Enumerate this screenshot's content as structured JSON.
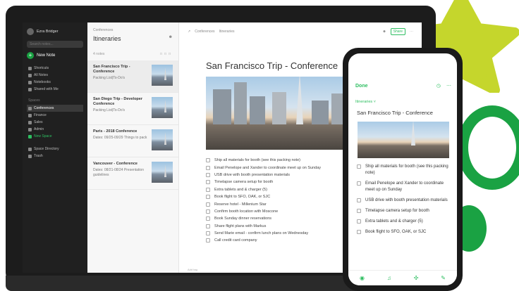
{
  "colors": {
    "accent": "#2dbe60",
    "sidebar_bg": "#202020",
    "star": "#c5d62c",
    "ring": "#1aa243"
  },
  "sidebar": {
    "account": "Ezra Bridger",
    "search_placeholder": "Search notes...",
    "new_note": "New Note",
    "items": [
      {
        "label": "Shortcuts",
        "icon": "star-icon"
      },
      {
        "label": "All Notes",
        "icon": "note-icon"
      },
      {
        "label": "Notebooks",
        "icon": "notebook-icon"
      },
      {
        "label": "Shared with Me",
        "icon": "people-icon"
      }
    ],
    "spaces_label": "Spaces",
    "spaces": [
      {
        "label": "Conferences",
        "active": true
      },
      {
        "label": "Finance"
      },
      {
        "label": "Sales"
      },
      {
        "label": "Admin"
      },
      {
        "label": "New Space",
        "green": true
      }
    ],
    "footer": [
      {
        "label": "Space Directory",
        "icon": "directory-icon"
      },
      {
        "label": "Trash",
        "icon": "trash-icon"
      }
    ]
  },
  "notelist": {
    "breadcrumb": "Conferences",
    "title": "Itineraries",
    "count": "4 notes",
    "notes": [
      {
        "title": "San Francisco Trip - Conference",
        "snippet": "Packing List|To-Do's"
      },
      {
        "title": "San Diego Trip - Developer Conference",
        "snippet": "Packing List|To-Do's"
      },
      {
        "title": "Paris - 2018 Conference",
        "snippet": "Dates: 09/25-09/29 Things to pack"
      },
      {
        "title": "Vancouver - Conference",
        "snippet": "Dates: 08/21-08/24 Presentation guidelines"
      }
    ]
  },
  "editor": {
    "crumb_space": "Conferences",
    "crumb_notebook": "Itineraries",
    "share": "Share",
    "title": "San Francisco Trip - Conference",
    "checklist": [
      "Ship all materials for booth (see this packing note)",
      "Email Penelope and Xander to coordinate meet up on Sunday",
      "USB drive with booth presentation materials",
      "Timelapse camera setup for booth",
      "Extra tablets and & charger (5)",
      "Book flight to SFO, OAK, or SJC",
      "Reserve hotel - Millenium Star",
      "Confirm booth location with Moscone",
      "Book Sunday dinner reservations",
      "Share flight plans with Markus",
      "Send Marie email - confirm lunch plans on Wednesday",
      "Call credit card company"
    ],
    "footer": "Add tag"
  },
  "phone": {
    "done": "Done",
    "notebook": "Itineraries",
    "title": "San Francisco Trip - Conference",
    "checklist": [
      "Ship all materials for booth (see this packing note)",
      "Email Penelope and Xander to coordinate meet up on Sunday",
      "USB drive with booth presentation materials",
      "Timelapse camera setup for booth",
      "Extra tablets and & charger (5)",
      "Book flight to SFO, OAK, or SJC"
    ]
  }
}
